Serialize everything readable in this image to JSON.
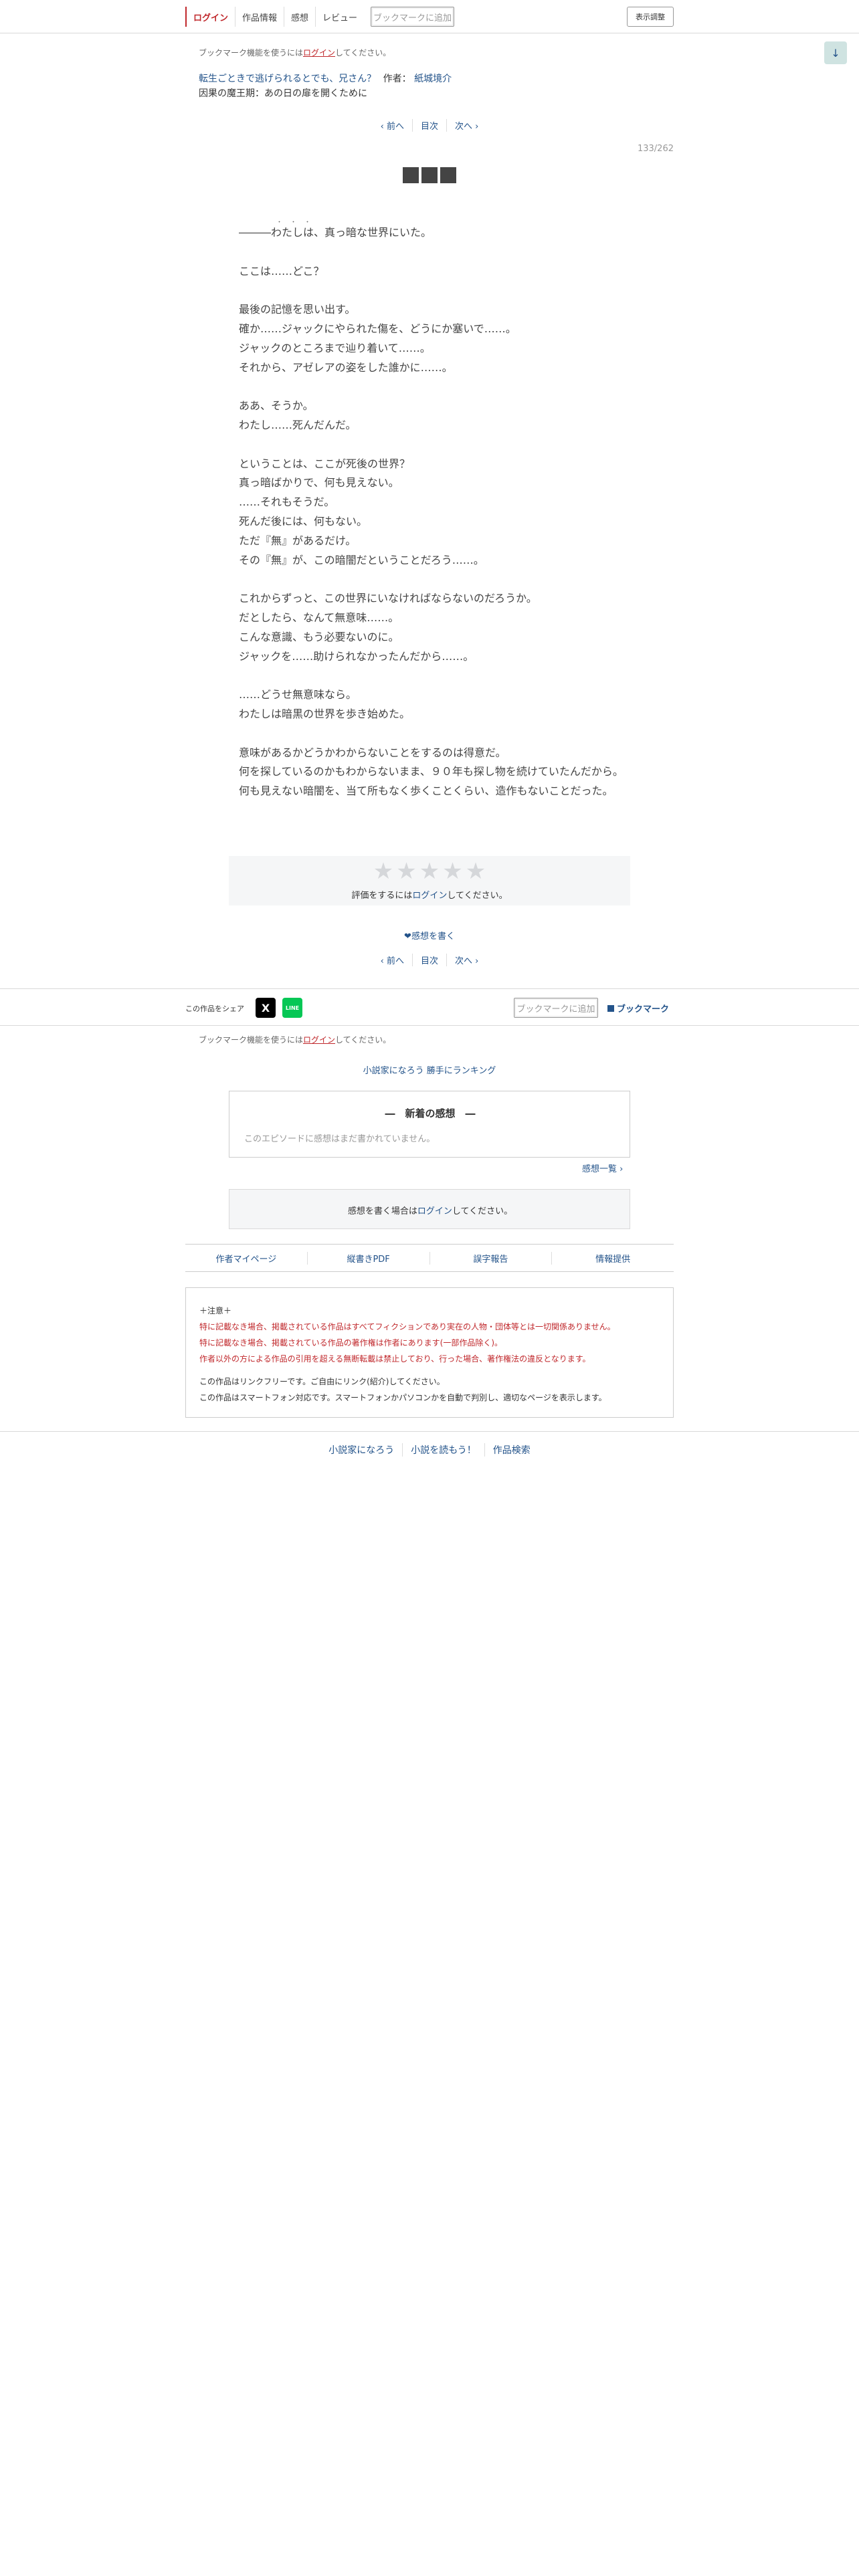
{
  "nav": {
    "items": [
      "ログイン",
      "作品情報",
      "感想",
      "レビュー"
    ],
    "bookmark_add": "ブックマークに追加",
    "display_settings": "表示調整",
    "scroll_arrow": "↓"
  },
  "bookmark_note": {
    "before": "ブックマーク機能を使うには",
    "login": "ログイン",
    "after": "してください。"
  },
  "series": {
    "title": "転生ごときで逃げられるとでも、兄さん？",
    "author_label": "作者：",
    "author": "紙城境介"
  },
  "chapter_label": "因果の魔王期：あの日の扉を開くために",
  "pager": {
    "prev": "‹ 前へ",
    "toc": "目次",
    "next": "次へ ›"
  },
  "page_count": "133/262",
  "chapter_title_blocks": 3,
  "ruby": "・・・",
  "body": [
    "―――わたしは、真っ暗な世界にいた。",
    "",
    "ここは……どこ？",
    "",
    "最後の記憶を思い出す。",
    "確か……ジャックにやられた傷を、どうにか塞いで……。",
    "ジャックのところまで辿り着いて……。",
    "それから、アゼレアの姿をした誰かに……。",
    "",
    "ああ、そうか。",
    "わたし……死んだんだ。",
    "",
    "ということは、ここが死後の世界？",
    "真っ暗ばかりで、何も見えない。",
    "……それもそうだ。",
    "死んだ後には、何もない。",
    "ただ『無』があるだけ。",
    "その『無』が、この暗闇だということだろう……。",
    "",
    "これからずっと、この世界にいなければならないのだろうか。",
    "だとしたら、なんて無意味……。",
    "こんな意識、もう必要ないのに。",
    "ジャックを……助けられなかったんだから……。",
    "",
    "……どうせ無意味なら。",
    "わたしは暗黒の世界を歩き始めた。",
    "",
    "意味があるかどうかわからないことをするのは得意だ。",
    "何を探しているのかもわからないまま、９０年も探し物を続けていたんだから。",
    "何も見えない暗闇を、当て所もなく歩くことくらい、造作もないことだった。"
  ],
  "rating": {
    "stars": 5,
    "before": "評価をするには",
    "login": "ログイン",
    "after": "してください。"
  },
  "write_review": "❤感想を書く",
  "share": {
    "label": "この作品をシェア",
    "x": "X",
    "line": "LINE",
    "bookmark_add": "ブックマークに追加",
    "bookmark": "ブックマーク"
  },
  "ranking_link": "小説家になろう 勝手にランキング",
  "reviews": {
    "title": "―　新着の感想　―",
    "empty": "このエピソードに感想はまだ書かれていません。",
    "list_link": "感想一覧 ›"
  },
  "login_review": {
    "before": "感想を書く場合は",
    "login": "ログイン",
    "after": "してください。"
  },
  "links": [
    "作者マイページ",
    "縦書きPDF",
    "誤字報告",
    "情報提供"
  ],
  "notice": {
    "head": "＋注意＋",
    "red": [
      "特に記載なき場合、掲載されている作品はすべてフィクションであり実在の人物・団体等とは一切関係ありません。",
      "特に記載なき場合、掲載されている作品の著作権は作者にあります(一部作品除く)。",
      "作者以外の方による作品の引用を超える無断転載は禁止しており、行った場合、著作権法の違反となります。"
    ],
    "gray": [
      "この作品はリンクフリーです。ご自由にリンク(紹介)してください。",
      "この作品はスマートフォン対応です。スマートフォンかパソコンかを自動で判別し、適切なページを表示します。"
    ]
  },
  "footer": [
    "小説家になろう",
    "小説を読もう！",
    "作品検索"
  ]
}
